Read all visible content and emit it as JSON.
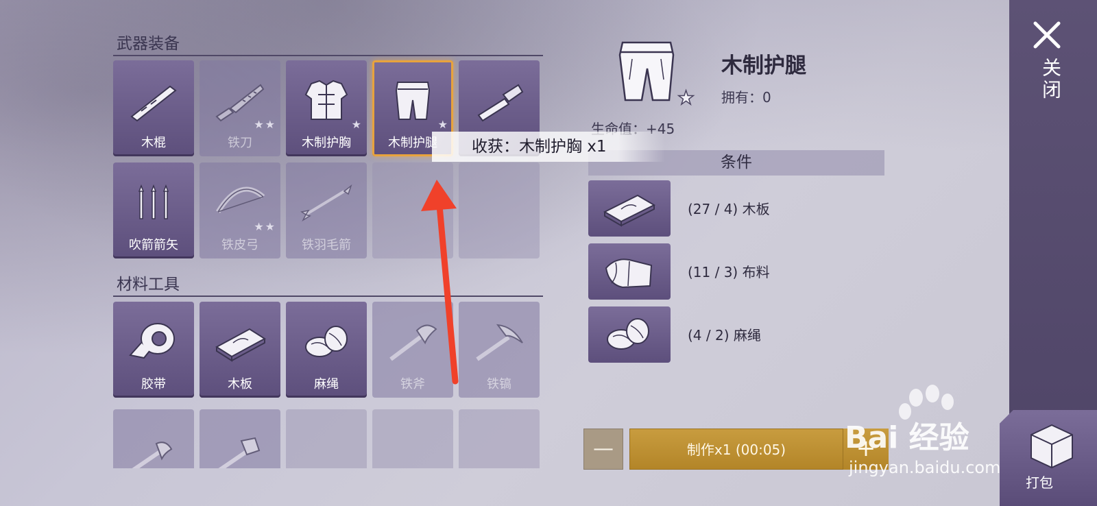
{
  "sections": {
    "weapons": "武器装备",
    "materials": "材料工具"
  },
  "weapons_row1": [
    {
      "label": "木棍",
      "state": "avail",
      "icon": "stick-icon"
    },
    {
      "label": "铁刀",
      "state": "locked",
      "icon": "knife-icon",
      "stars": "★★"
    },
    {
      "label": "木制护胸",
      "state": "avail",
      "icon": "chest-armor-icon",
      "stars": "★"
    },
    {
      "label": "木制护腿",
      "state": "selected",
      "icon": "leg-armor-icon",
      "stars": "★"
    },
    {
      "label": "",
      "state": "avail",
      "icon": "club-icon"
    }
  ],
  "weapons_row2": [
    {
      "label": "吹箭箭矢",
      "state": "avail",
      "icon": "darts-icon"
    },
    {
      "label": "铁皮弓",
      "state": "locked",
      "icon": "bow-icon",
      "stars": "★★"
    },
    {
      "label": "铁羽毛箭",
      "state": "locked",
      "icon": "arrow-icon"
    }
  ],
  "materials_row1": [
    {
      "label": "胶带",
      "state": "avail",
      "icon": "tape-icon"
    },
    {
      "label": "木板",
      "state": "avail",
      "icon": "plank-icon"
    },
    {
      "label": "麻绳",
      "state": "avail",
      "icon": "rope-icon"
    },
    {
      "label": "铁斧",
      "state": "locked",
      "icon": "axe-icon"
    },
    {
      "label": "铁镐",
      "state": "locked",
      "icon": "pickaxe-icon"
    }
  ],
  "detail": {
    "name": "木制护腿",
    "owned": "拥有：0",
    "stat": "生命值：+45",
    "conditions_title": "条件",
    "conditions": [
      {
        "text": "(27 / 4) 木板",
        "icon": "plank-icon"
      },
      {
        "text": "(11 / 3) 布料",
        "icon": "cloth-icon"
      },
      {
        "text": "(4 / 2) 麻绳",
        "icon": "rope-icon"
      }
    ]
  },
  "toast": "收获：木制护胸 x1",
  "controls": {
    "minus": "—",
    "make": "制作x1 (00:05)",
    "plus": "+"
  },
  "close_label": "关闭",
  "pack_label": "打包",
  "watermark": {
    "brand": "Bai  经验",
    "url": "jingyan.baidu.com"
  },
  "colors": {
    "accent": "#e8a33d",
    "button_gold": "#c89c3f",
    "cell_purple": "#6b5d8a",
    "annotation_arrow": "#f0412a"
  }
}
